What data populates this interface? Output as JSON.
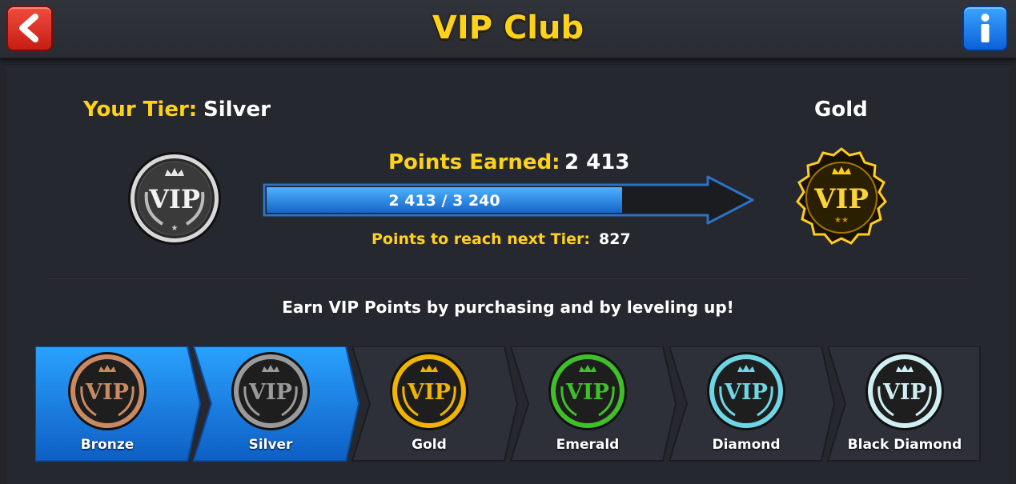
{
  "header": {
    "title": "VIP Club",
    "back_icon": "chevron-left-icon",
    "info_icon": "info-icon"
  },
  "current": {
    "tier_label": "Your Tier:",
    "tier_value": "Silver",
    "next_tier": "Gold",
    "points_label": "Points Earned:",
    "points_value": "2 413",
    "progress_text": "2 413 / 3 240",
    "progress_fraction": 0.745,
    "reach_label": "Points to reach next Tier:",
    "reach_value": "827"
  },
  "earn_text": "Earn VIP Points by purchasing and by leveling up!",
  "tiers": [
    {
      "name": "Bronze",
      "achieved": true,
      "color": "#c98a63"
    },
    {
      "name": "Silver",
      "achieved": true,
      "color": "#9a9a9a"
    },
    {
      "name": "Gold",
      "achieved": false,
      "color": "#f0b400"
    },
    {
      "name": "Emerald",
      "achieved": false,
      "color": "#3fbf2a"
    },
    {
      "name": "Diamond",
      "achieved": false,
      "color": "#6fd6e6"
    },
    {
      "name": "Black Diamond",
      "achieved": false,
      "color": "#cfeff2"
    }
  ],
  "badge_text": "VIP",
  "colors": {
    "accent_yellow": "#ffd21a",
    "active_blue": "#1c8fe8",
    "inactive_tile": "#2d3039"
  }
}
